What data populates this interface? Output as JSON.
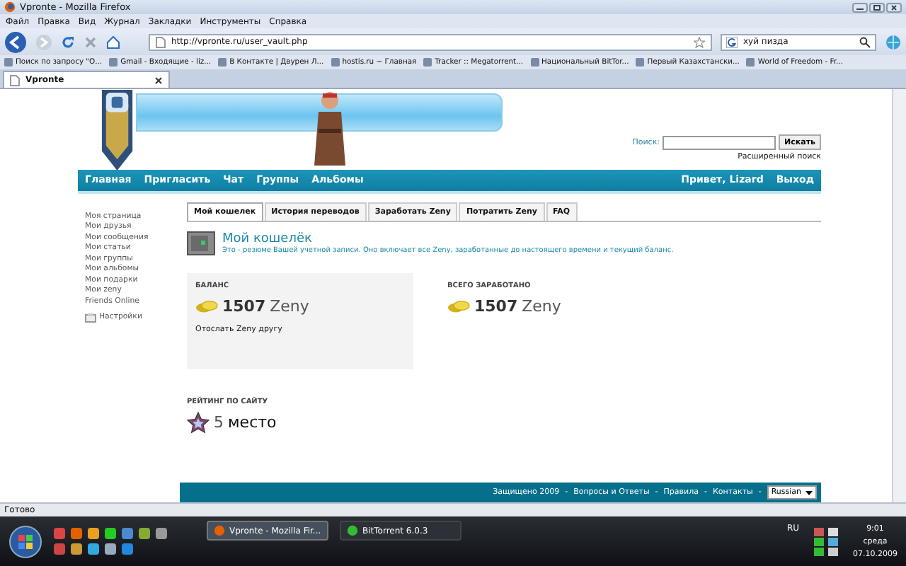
{
  "window": {
    "title": "Vpronte - Mozilla Firefox"
  },
  "menu": [
    "Файл",
    "Правка",
    "Вид",
    "Журнал",
    "Закладки",
    "Инструменты",
    "Справка"
  ],
  "address": {
    "value": "http://vpronte.ru/user_vault.php"
  },
  "web_search": {
    "value": "хуй пизда"
  },
  "bookmarks": [
    "Поиск по запросу \"О...",
    "Gmail - Входящие - liz...",
    "В Контакте | Двурен Л...",
    "hostis.ru ~ Главная",
    "Tracker :: Megatorrent...",
    "Национальный BitTor...",
    "Первый Казахстански...",
    "World of Freedom - Fr..."
  ],
  "browser_tabs": [
    {
      "label": "Vpronte",
      "selected": true
    }
  ],
  "site_search": {
    "label": "Поиск:",
    "button": "Искать",
    "advanced": "Расширенный поиск"
  },
  "nav": {
    "left": [
      "Главная",
      "Пригласить",
      "Чат",
      "Группы",
      "Альбомы"
    ],
    "right": [
      "Привет, Lizard",
      "Выход"
    ]
  },
  "sidebar": {
    "items": [
      "Моя страница",
      "Мои друзья",
      "Мои сообщения",
      "Мои статьи",
      "Мои группы",
      "Мои альбомы",
      "Мои подарки",
      "Мои zeny",
      "Friends Online"
    ],
    "settings": "Настройки"
  },
  "tabs": [
    {
      "label": "Мой кошелек",
      "selected": true
    },
    {
      "label": "История переводов",
      "selected": false
    },
    {
      "label": "Заработать Zeny",
      "selected": false
    },
    {
      "label": "Потратить Zeny",
      "selected": false
    },
    {
      "label": "FAQ",
      "selected": false
    }
  ],
  "wallet": {
    "title": "Мой кошелёк",
    "description": "Это - резюме Вашей учетной записи. Оно включает все Zeny, заработанные до настоящего времени и текущий баланс."
  },
  "balance": {
    "label": "БАЛАНС",
    "amount": "1507",
    "unit": "Zeny",
    "link": "Отослать Zeny другу"
  },
  "total": {
    "label": "ВСЕГО ЗАРАБОТАНО",
    "amount": "1507",
    "unit": "Zeny"
  },
  "rating": {
    "label": "РЕЙТИНГ ПО САЙТУ",
    "place": "5",
    "unit": "место"
  },
  "footer": {
    "links": [
      "Защищено 2009",
      "Вопросы и Ответы",
      "Правила",
      "Контакты"
    ],
    "separator": "-",
    "language": "Russian"
  },
  "status_bar": "Готово",
  "taskbar": {
    "tasks": [
      {
        "label": "Vpronte - Mozilla Fir...",
        "selected": true
      },
      {
        "label": "BitTorrent 6.0.3",
        "selected": false
      }
    ],
    "language": "RU",
    "time": "9:01",
    "day": "среда",
    "date": "07.10.2009"
  }
}
